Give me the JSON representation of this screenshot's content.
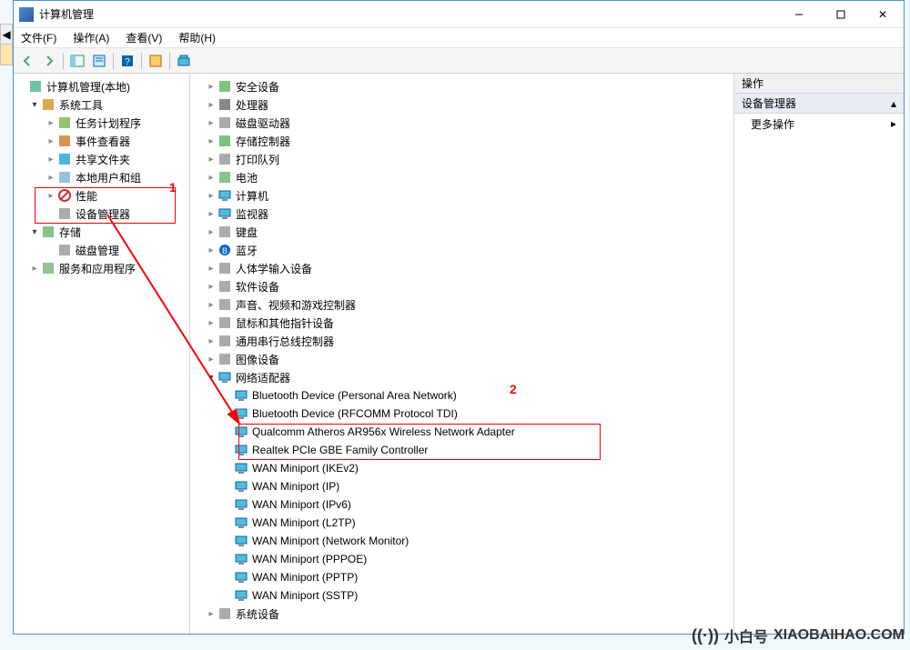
{
  "window": {
    "title": "计算机管理",
    "close_glyph": "✕"
  },
  "menubar": {
    "file": "文件(F)",
    "action": "操作(A)",
    "view": "查看(V)",
    "help": "帮助(H)"
  },
  "right_panel": {
    "header": "操作",
    "section": "设备管理器",
    "action": "更多操作"
  },
  "left_tree": [
    {
      "d": 0,
      "arrow": "none",
      "icon": "console",
      "label": "计算机管理(本地)"
    },
    {
      "d": 1,
      "arrow": "open",
      "icon": "tools",
      "label": "系统工具"
    },
    {
      "d": 2,
      "arrow": "closed",
      "icon": "scheduler",
      "label": "任务计划程序"
    },
    {
      "d": 2,
      "arrow": "closed",
      "icon": "eventvwr",
      "label": "事件查看器"
    },
    {
      "d": 2,
      "arrow": "closed",
      "icon": "share",
      "label": "共享文件夹"
    },
    {
      "d": 2,
      "arrow": "closed",
      "icon": "users",
      "label": "本地用户和组"
    },
    {
      "d": 2,
      "arrow": "closed",
      "icon": "perf",
      "label": "性能"
    },
    {
      "d": 2,
      "arrow": "none",
      "icon": "devmgr",
      "label": "设备管理器"
    },
    {
      "d": 1,
      "arrow": "open",
      "icon": "storage",
      "label": "存储"
    },
    {
      "d": 2,
      "arrow": "none",
      "icon": "diskmgr",
      "label": "磁盘管理"
    },
    {
      "d": 1,
      "arrow": "closed",
      "icon": "services",
      "label": "服务和应用程序"
    }
  ],
  "mid_tree": [
    {
      "d": 1,
      "arrow": "closed",
      "icon": "security",
      "label": "安全设备"
    },
    {
      "d": 1,
      "arrow": "closed",
      "icon": "cpu",
      "label": "处理器"
    },
    {
      "d": 1,
      "arrow": "closed",
      "icon": "disk",
      "label": "磁盘驱动器"
    },
    {
      "d": 1,
      "arrow": "closed",
      "icon": "storagectl",
      "label": "存储控制器"
    },
    {
      "d": 1,
      "arrow": "closed",
      "icon": "printer",
      "label": "打印队列"
    },
    {
      "d": 1,
      "arrow": "closed",
      "icon": "battery",
      "label": "电池"
    },
    {
      "d": 1,
      "arrow": "closed",
      "icon": "computer",
      "label": "计算机"
    },
    {
      "d": 1,
      "arrow": "closed",
      "icon": "monitor",
      "label": "监视器"
    },
    {
      "d": 1,
      "arrow": "closed",
      "icon": "keyboard",
      "label": "键盘"
    },
    {
      "d": 1,
      "arrow": "closed",
      "icon": "bluetooth",
      "label": "蓝牙"
    },
    {
      "d": 1,
      "arrow": "closed",
      "icon": "hid",
      "label": "人体学输入设备"
    },
    {
      "d": 1,
      "arrow": "closed",
      "icon": "software",
      "label": "软件设备"
    },
    {
      "d": 1,
      "arrow": "closed",
      "icon": "sound",
      "label": "声音、视频和游戏控制器"
    },
    {
      "d": 1,
      "arrow": "closed",
      "icon": "mouse",
      "label": "鼠标和其他指针设备"
    },
    {
      "d": 1,
      "arrow": "closed",
      "icon": "usb",
      "label": "通用串行总线控制器"
    },
    {
      "d": 1,
      "arrow": "closed",
      "icon": "imaging",
      "label": "图像设备"
    },
    {
      "d": 1,
      "arrow": "open",
      "icon": "netadapter",
      "label": "网络适配器"
    },
    {
      "d": 2,
      "arrow": "none",
      "icon": "net",
      "label": "Bluetooth Device (Personal Area Network)"
    },
    {
      "d": 2,
      "arrow": "none",
      "icon": "net",
      "label": "Bluetooth Device (RFCOMM Protocol TDI)"
    },
    {
      "d": 2,
      "arrow": "none",
      "icon": "net",
      "label": "Qualcomm Atheros AR956x Wireless Network Adapter"
    },
    {
      "d": 2,
      "arrow": "none",
      "icon": "net",
      "label": "Realtek PCIe GBE Family Controller"
    },
    {
      "d": 2,
      "arrow": "none",
      "icon": "net",
      "label": "WAN Miniport (IKEv2)"
    },
    {
      "d": 2,
      "arrow": "none",
      "icon": "net",
      "label": "WAN Miniport (IP)"
    },
    {
      "d": 2,
      "arrow": "none",
      "icon": "net",
      "label": "WAN Miniport (IPv6)"
    },
    {
      "d": 2,
      "arrow": "none",
      "icon": "net",
      "label": "WAN Miniport (L2TP)"
    },
    {
      "d": 2,
      "arrow": "none",
      "icon": "net",
      "label": "WAN Miniport (Network Monitor)"
    },
    {
      "d": 2,
      "arrow": "none",
      "icon": "net",
      "label": "WAN Miniport (PPPOE)"
    },
    {
      "d": 2,
      "arrow": "none",
      "icon": "net",
      "label": "WAN Miniport (PPTP)"
    },
    {
      "d": 2,
      "arrow": "none",
      "icon": "net",
      "label": "WAN Miniport (SSTP)"
    },
    {
      "d": 1,
      "arrow": "closed",
      "icon": "system",
      "label": "系统设备"
    }
  ],
  "annotations": {
    "label1": "1",
    "label2": "2"
  },
  "watermark": {
    "brand": "小白号",
    "domain": "XIAOBAIHAO.COM"
  }
}
